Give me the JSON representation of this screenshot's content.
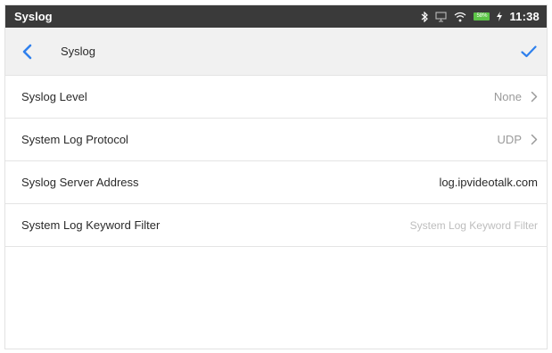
{
  "status_bar": {
    "title": "Syslog",
    "battery_level": "58%",
    "time": "11:38",
    "icons": [
      "bluetooth-icon",
      "screen-cast-icon",
      "wifi-icon",
      "battery-icon",
      "charging-icon"
    ]
  },
  "header": {
    "title": "Syslog",
    "accent_color": "#2f80ed"
  },
  "settings": {
    "rows": [
      {
        "label": "Syslog Level",
        "value": "None"
      },
      {
        "label": "System Log Protocol",
        "value": "UDP"
      },
      {
        "label": "Syslog Server Address",
        "value": "log.ipvideotalk.com"
      },
      {
        "label": "System Log Keyword Filter",
        "value": "",
        "placeholder": "System Log Keyword Filter"
      }
    ]
  }
}
